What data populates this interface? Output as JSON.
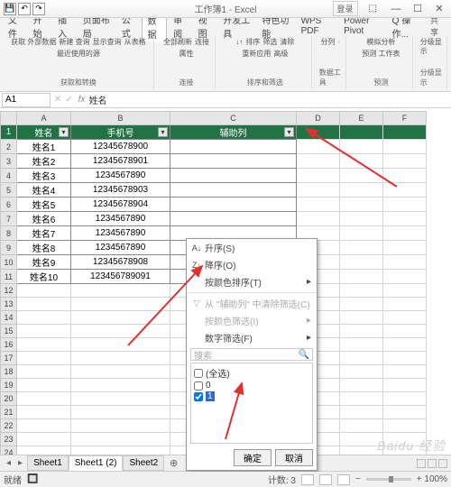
{
  "title": "工作簿1 - Excel",
  "login": "登录",
  "menus": [
    "文件",
    "开始",
    "插入",
    "页面布局",
    "公式",
    "数据",
    "审阅",
    "视图",
    "开发工具",
    "特色功能",
    "WPS PDF",
    "Power Pivot",
    "Q 操作..."
  ],
  "active_menu": 5,
  "share": "共享",
  "ribbon_groups": [
    {
      "label": "获取和转换",
      "lines": [
        "获取\n外部数据",
        "新建\n查询",
        "显示查询",
        "从表格",
        "最近使用的源"
      ]
    },
    {
      "label": "连接",
      "lines": [
        "全部刷新",
        "连接",
        "属性"
      ]
    },
    {
      "label": "排序和筛选",
      "lines": [
        "↓↑",
        "排序",
        "筛选",
        "清除",
        "重新应用",
        "高级"
      ]
    },
    {
      "label": "数据工具",
      "lines": [
        "分列",
        "·"
      ]
    },
    {
      "label": "预测",
      "lines": [
        "模拟分析",
        "预测\n工作表"
      ]
    },
    {
      "label": "分级显示",
      "lines": [
        "分级显示"
      ]
    }
  ],
  "namebox": "A1",
  "formula": "姓名",
  "columns": [
    "",
    "A",
    "B",
    "C",
    "D",
    "E",
    "F"
  ],
  "headers": [
    "姓名",
    "手机号",
    "辅助列"
  ],
  "rows": [
    {
      "n": "姓名1",
      "p": "12345678900"
    },
    {
      "n": "姓名2",
      "p": "12345678901"
    },
    {
      "n": "姓名3",
      "p": "1234567890"
    },
    {
      "n": "姓名4",
      "p": "12345678903"
    },
    {
      "n": "姓名5",
      "p": "12345678904"
    },
    {
      "n": "姓名6",
      "p": "1234567890"
    },
    {
      "n": "姓名7",
      "p": "1234567890"
    },
    {
      "n": "姓名8",
      "p": "1234567890"
    },
    {
      "n": "姓名9",
      "p": "12345678908"
    },
    {
      "n": "姓名10",
      "p": "123456789091"
    }
  ],
  "filter": {
    "sort_asc": "升序(S)",
    "sort_desc": "降序(O)",
    "sort_color": "按颜色排序(T)",
    "clear": "从 \"辅助列\" 中清除筛选(C)",
    "color_filter": "按颜色筛选(I)",
    "num_filter": "数字筛选(F)",
    "search": "搜索",
    "opt_all": "(全选)",
    "opt_0": "0",
    "opt_1": "1",
    "ok": "确定",
    "cancel": "取消"
  },
  "sheets": [
    "Sheet1",
    "Sheet1 (2)",
    "Sheet2"
  ],
  "active_sheet": 1,
  "status_left": "就绪",
  "status_filter": "",
  "count": "计数: 3",
  "zoom": "+ 100%",
  "watermark": "Baidu 经验"
}
